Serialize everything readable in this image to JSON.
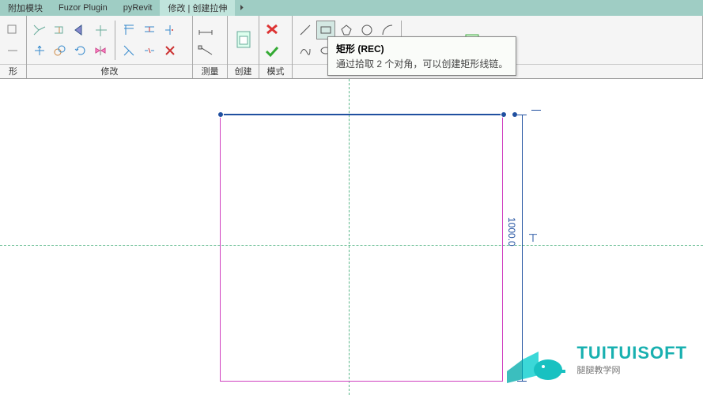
{
  "tabs": {
    "addon": "附加模块",
    "fuzor": "Fuzor Plugin",
    "pyrevit": "pyRevit",
    "modify": "修改 | 创建拉伸"
  },
  "panels": {
    "shape": "形",
    "modify": "修改",
    "measure": "测量",
    "create": "创建",
    "mode": "模式"
  },
  "tooltip": {
    "title": "矩形 (REC)",
    "desc": "通过拾取 2 个对角，可以创建矩形线链。"
  },
  "dimension": "1000.0",
  "watermark": {
    "main": "TUITUISOFT",
    "sub": "腿腿教学网"
  }
}
